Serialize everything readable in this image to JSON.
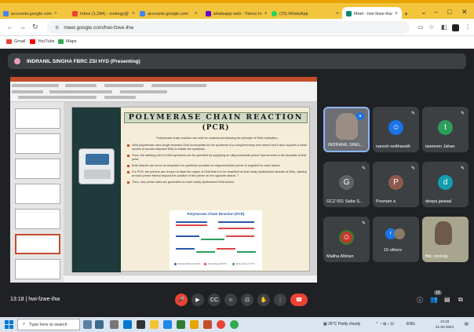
{
  "browser": {
    "tabs": [
      {
        "label": "accounts.google.com",
        "color": "#4285f4"
      },
      {
        "label": "Inbox (1,284) - zoology@",
        "color": "#ea4335"
      },
      {
        "label": "accounts.google.com",
        "color": "#4285f4"
      },
      {
        "label": "whatsapp web - Yahoo In",
        "color": "#6001d2"
      },
      {
        "label": "(15) WhatsApp",
        "color": "#25d366"
      },
      {
        "label": "Meet - hwi-fzwe-ihw",
        "color": "#00897b",
        "active": true
      }
    ],
    "new_tab_label": "+",
    "url": "meet.google.com/hwi-fzwe-ihw",
    "bookmarks": [
      {
        "label": "Gmail",
        "color": "#ea4335"
      },
      {
        "label": "YouTube",
        "color": "#ff0000"
      },
      {
        "label": "Maps",
        "color": "#34a853"
      }
    ]
  },
  "meet": {
    "presenter_label": "INDRANIL SINGHA FBRC ZSI HYD (Presenting)",
    "meeting_code": "hwi-fzwe-ihw",
    "time": "13:18",
    "participants": [
      {
        "name": "INDRANIL SING...",
        "type": "video",
        "color": "#5f6368"
      },
      {
        "name": "naresh netthavath",
        "type": "photo",
        "color": "#1a73e8"
      },
      {
        "name": "tasneem Jahan",
        "type": "letter",
        "letter": "t",
        "color": "#2e9e5b"
      },
      {
        "name": "GCZ 001 Saba S...",
        "type": "letter",
        "letter": "G",
        "color": "#5f6368"
      },
      {
        "name": "Poonam a",
        "type": "letter",
        "letter": "P",
        "color": "#8d5a4e"
      },
      {
        "name": "deepa jaiswal",
        "type": "letter",
        "letter": "d",
        "color": "#129eaf"
      },
      {
        "name": "Maliha Afshan",
        "type": "photo",
        "color": "#d33"
      },
      {
        "name": "10 others",
        "type": "group",
        "color": "#1a73e8"
      },
      {
        "name": "ffdc zoology",
        "type": "video",
        "color": "#8a8f7a"
      }
    ],
    "people_count": "19"
  },
  "slide": {
    "title": "POLYMERASE CHAIN REACTION",
    "subtitle": "(PCR)",
    "intro": "Polymerase chain reaction can best be understood following the principle of DNA replication.",
    "bullets": [
      "DNA polymerase uses single stranded DNA as template for the synthesis of a complementary new strand and it also requires a small section of double stranded DNA to initiate the synthesis.",
      "Thus, the starting point of DNA synthesis can be specified by supplying an oligonucleotide primer that anneals to the template at that point.",
      "Both strands can serve as templates for synthesis provided an oligonucleotide primer is supplied for each strand.",
      "For PCR, the primers are chosen to flank the region of DNA that is to be amplified so that newly synthesized strands of DNA, starting at each primer extend beyond the position of the primer on the opposite strand. ?",
      "Thus, new primer sites are generated on each newly synthesized DNA strand."
    ],
    "diagram_title": "Polymerase Chain Reaction (PCR)",
    "diagram_legend": [
      "Denaturation at 94°C",
      "Annealing at 54°C",
      "Extension at 72°C"
    ]
  },
  "taskbar": {
    "search_placeholder": "Type here to search",
    "weather": "26°C  Partly cloudy",
    "lang": "ENG",
    "clock_time": "13:18",
    "clock_date": "21-02-2024"
  }
}
